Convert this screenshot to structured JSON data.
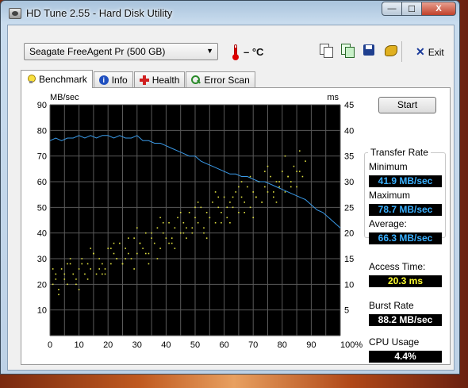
{
  "window": {
    "title": "HD Tune 2.55 - Hard Disk Utility",
    "buttons": {
      "minimize": "—",
      "maximize": "☐",
      "close": "X"
    }
  },
  "toolbar": {
    "drive": "Seagate FreeAgent Pr (500 GB)",
    "temperature": "– °C",
    "icons": [
      "copy-text-icon",
      "copy-screenshot-icon",
      "save-icon",
      "options-icon"
    ],
    "exit_label": "Exit"
  },
  "tabs": [
    {
      "label": "Benchmark",
      "icon": "bulb-icon",
      "active": true
    },
    {
      "label": "Info",
      "icon": "info-icon",
      "active": false
    },
    {
      "label": "Health",
      "icon": "health-cross-icon",
      "active": false
    },
    {
      "label": "Error Scan",
      "icon": "magnifier-icon",
      "active": false
    }
  ],
  "benchmark": {
    "start_label": "Start",
    "transfer_rate_title": "Transfer Rate",
    "minimum_label": "Minimum",
    "minimum_value": "41.9 MB/sec",
    "maximum_label": "Maximum",
    "maximum_value": "78.7 MB/sec",
    "average_label": "Average:",
    "average_value": "66.3 MB/sec",
    "access_time_label": "Access Time:",
    "access_time_value": "20.3 ms",
    "burst_rate_label": "Burst Rate",
    "burst_rate_value": "88.2 MB/sec",
    "cpu_usage_label": "CPU Usage",
    "cpu_usage_value": "4.4%"
  },
  "colors": {
    "plot_background": "#000000",
    "grid": "#5a5a5a",
    "transfer_line": "#3a9ae8",
    "access_points": "#e0e040",
    "value_blue": "#3ab0ff",
    "value_yellow": "#ffff30"
  },
  "chart_data": {
    "type": "line",
    "left_axis_label": "MB/sec",
    "right_axis_label": "ms",
    "x_ticks": [
      "0",
      "10",
      "20",
      "30",
      "40",
      "50",
      "60",
      "70",
      "80",
      "90",
      "100%"
    ],
    "y_left_ticks": [
      "10",
      "20",
      "30",
      "40",
      "50",
      "60",
      "70",
      "80",
      "90"
    ],
    "y_right_ticks": [
      "5",
      "10",
      "15",
      "20",
      "25",
      "30",
      "35",
      "40",
      "45"
    ],
    "ylim_left": [
      0,
      90
    ],
    "ylim_right": [
      0,
      45
    ],
    "xlim": [
      0,
      100
    ],
    "grid": true,
    "series": [
      {
        "name": "Transfer Rate",
        "axis": "left",
        "x": [
          0,
          2,
          4,
          6,
          8,
          10,
          12,
          14,
          16,
          18,
          20,
          22,
          24,
          26,
          28,
          30,
          32,
          34,
          36,
          38,
          40,
          42,
          44,
          46,
          48,
          50,
          52,
          54,
          56,
          58,
          60,
          62,
          64,
          66,
          68,
          70,
          72,
          74,
          76,
          78,
          80,
          82,
          84,
          86,
          88,
          90,
          92,
          94,
          96,
          98,
          100
        ],
        "y": [
          76,
          77,
          76,
          77,
          77,
          78,
          77,
          78,
          77,
          78,
          78,
          77,
          78,
          77,
          77,
          78,
          76,
          76,
          75,
          75,
          74,
          73,
          72,
          71,
          70,
          70,
          68,
          67,
          66,
          65,
          64,
          63,
          63,
          62,
          62,
          61,
          60,
          60,
          59,
          58,
          57,
          56,
          55,
          54,
          53,
          51,
          49,
          48,
          46,
          44,
          42
        ]
      },
      {
        "name": "Access Time",
        "axis": "right",
        "type": "scatter",
        "x": [
          1,
          2,
          3,
          4,
          5,
          6,
          7,
          8,
          9,
          10,
          11,
          12,
          13,
          14,
          15,
          16,
          17,
          18,
          19,
          20,
          21,
          22,
          23,
          24,
          25,
          26,
          27,
          28,
          29,
          30,
          31,
          32,
          33,
          34,
          35,
          36,
          37,
          38,
          39,
          40,
          41,
          42,
          43,
          44,
          45,
          46,
          47,
          48,
          49,
          50,
          51,
          52,
          53,
          54,
          55,
          56,
          57,
          58,
          59,
          60,
          61,
          62,
          63,
          64,
          65,
          66,
          67,
          68,
          69,
          70,
          71,
          72,
          73,
          74,
          75,
          76,
          77,
          78,
          79,
          80,
          81,
          82,
          83,
          84,
          85,
          86,
          87,
          88,
          1,
          3,
          5,
          7,
          9,
          11,
          13,
          15,
          17,
          19,
          21,
          23,
          25,
          27,
          29,
          31,
          33,
          35,
          37,
          39,
          41,
          43,
          45,
          47,
          49,
          51,
          53,
          55,
          57,
          59,
          61,
          63,
          65,
          67,
          69,
          71,
          73,
          75,
          77,
          79,
          81,
          83,
          85,
          2,
          6,
          10,
          14,
          18,
          22,
          26,
          30,
          34,
          38,
          42,
          46,
          50,
          54,
          58,
          62,
          66,
          70,
          74,
          78,
          82,
          86
        ],
        "y": [
          10,
          12,
          9,
          13,
          11,
          10,
          14,
          12,
          11,
          13,
          15,
          12,
          14,
          13,
          16,
          12,
          15,
          14,
          13,
          17,
          14,
          16,
          15,
          18,
          14,
          17,
          16,
          15,
          19,
          16,
          18,
          17,
          20,
          16,
          19,
          18,
          21,
          17,
          20,
          19,
          22,
          18,
          21,
          23,
          20,
          22,
          21,
          24,
          20,
          23,
          22,
          25,
          21,
          24,
          23,
          26,
          22,
          25,
          24,
          27,
          23,
          26,
          25,
          28,
          24,
          27,
          26,
          29,
          25,
          28,
          27,
          30,
          26,
          29,
          28,
          31,
          27,
          30,
          29,
          32,
          28,
          31,
          30,
          33,
          29,
          32,
          31,
          34,
          13,
          8,
          12,
          15,
          10,
          14,
          11,
          16,
          13,
          12,
          17,
          15,
          14,
          19,
          13,
          18,
          16,
          20,
          15,
          22,
          18,
          17,
          24,
          19,
          21,
          26,
          20,
          23,
          28,
          22,
          25,
          27,
          29,
          24,
          31,
          27,
          26,
          33,
          28,
          30,
          35,
          29,
          32,
          11,
          14,
          9,
          17,
          12,
          18,
          15,
          21,
          14,
          23,
          19,
          20,
          25,
          19,
          27,
          22,
          30,
          23,
          32,
          26,
          31,
          36
        ]
      }
    ]
  }
}
